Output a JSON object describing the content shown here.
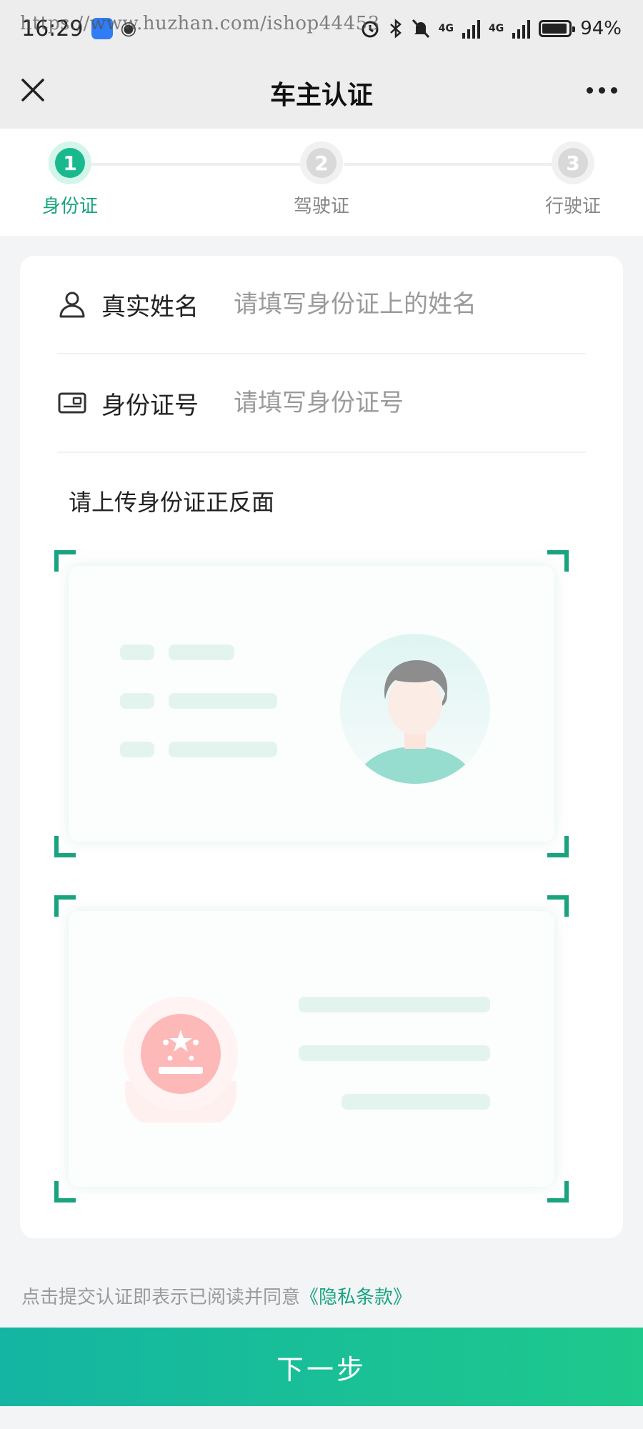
{
  "status_bar": {
    "time": "16:29",
    "watermark": "https://www.huzhan.com/ishop44453",
    "network": "4G",
    "battery": "94%",
    "battery_level": 0.94
  },
  "nav": {
    "title": "车主认证"
  },
  "steps": [
    {
      "number": "1",
      "label": "身份证",
      "state": "active"
    },
    {
      "number": "2",
      "label": "驾驶证",
      "state": "inactive"
    },
    {
      "number": "3",
      "label": "行驶证",
      "state": "inactive"
    }
  ],
  "form": {
    "name_label": "真实姓名",
    "name_placeholder": "请填写身份证上的姓名",
    "id_label": "身份证号",
    "id_placeholder": "请填写身份证号",
    "upload_title": "请上传身份证正反面"
  },
  "agreement": {
    "text": "点击提交认证即表示已阅读并同意",
    "link": "《隐私条款》"
  },
  "next_button": "下一步",
  "colors": {
    "accent": "#19b98e",
    "accent_text": "#17a47f",
    "corner": "#1aa37f",
    "button_start": "#14b5a2",
    "button_end": "#1ec98c",
    "emblem": "#fdb8b8"
  },
  "icons": {
    "close": "close-icon",
    "more": "more-icon",
    "user": "user-icon",
    "id_card": "id-card-icon"
  }
}
